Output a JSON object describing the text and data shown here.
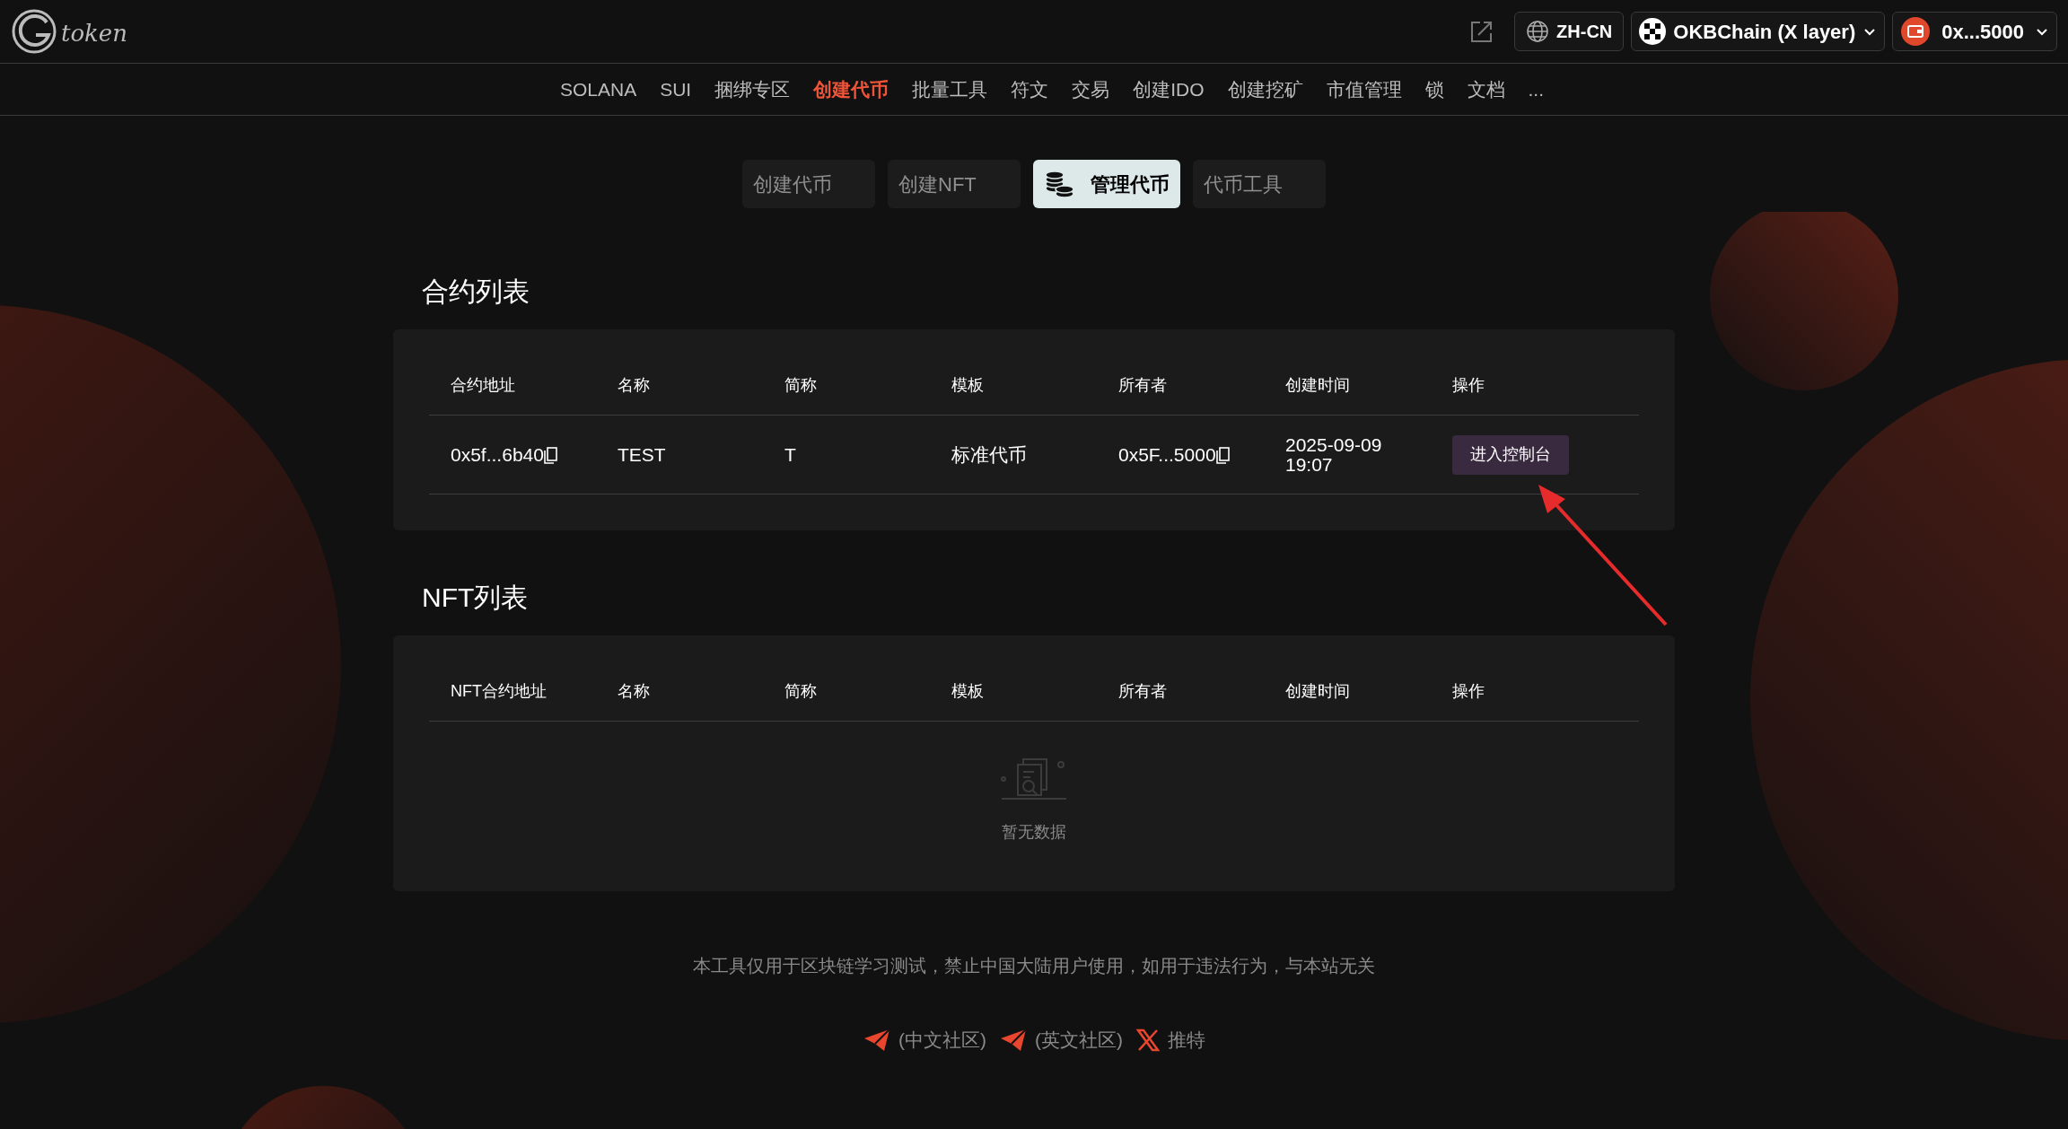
{
  "header": {
    "logo_text": "token",
    "language": "ZH-CN",
    "network": "OKBChain (X layer)",
    "wallet": "0x...5000"
  },
  "nav": [
    {
      "label": "SOLANA",
      "selected": false
    },
    {
      "label": "SUI",
      "selected": false
    },
    {
      "label": "捆绑专区",
      "selected": false
    },
    {
      "label": "创建代币",
      "selected": true
    },
    {
      "label": "批量工具",
      "selected": false
    },
    {
      "label": "符文",
      "selected": false
    },
    {
      "label": "交易",
      "selected": false
    },
    {
      "label": "创建IDO",
      "selected": false
    },
    {
      "label": "创建挖矿",
      "selected": false
    },
    {
      "label": "市值管理",
      "selected": false
    },
    {
      "label": "锁",
      "selected": false
    },
    {
      "label": "文档",
      "selected": false
    },
    {
      "label": "...",
      "selected": false
    }
  ],
  "sub_tabs": [
    {
      "label": "创建代币",
      "selected": false
    },
    {
      "label": "创建NFT",
      "selected": false
    },
    {
      "label": "管理代币",
      "selected": true
    },
    {
      "label": "代币工具",
      "selected": false
    }
  ],
  "contract_list": {
    "title": "合约列表",
    "columns": [
      "合约地址",
      "名称",
      "简称",
      "模板",
      "所有者",
      "创建时间",
      "操作"
    ],
    "rows": [
      {
        "address": "0x5f...6b40",
        "name": "TEST",
        "symbol": "T",
        "template": "标准代币",
        "owner": "0x5F...5000",
        "created": [
          "2025-09-09",
          "19:07"
        ],
        "action": "进入控制台"
      }
    ]
  },
  "nft_list": {
    "title": "NFT列表",
    "columns": [
      "NFT合约地址",
      "名称",
      "简称",
      "模板",
      "所有者",
      "创建时间",
      "操作"
    ],
    "empty_text": "暂无数据"
  },
  "footer": {
    "disclaimer": "本工具仅用于区块链学习测试，禁止中国大陆用户使用，如用于违法行为，与本站无关",
    "links": [
      {
        "kind": "telegram",
        "label": "(中文社区)"
      },
      {
        "kind": "telegram",
        "label": "(英文社区)"
      },
      {
        "kind": "x",
        "label": "推特"
      }
    ]
  }
}
